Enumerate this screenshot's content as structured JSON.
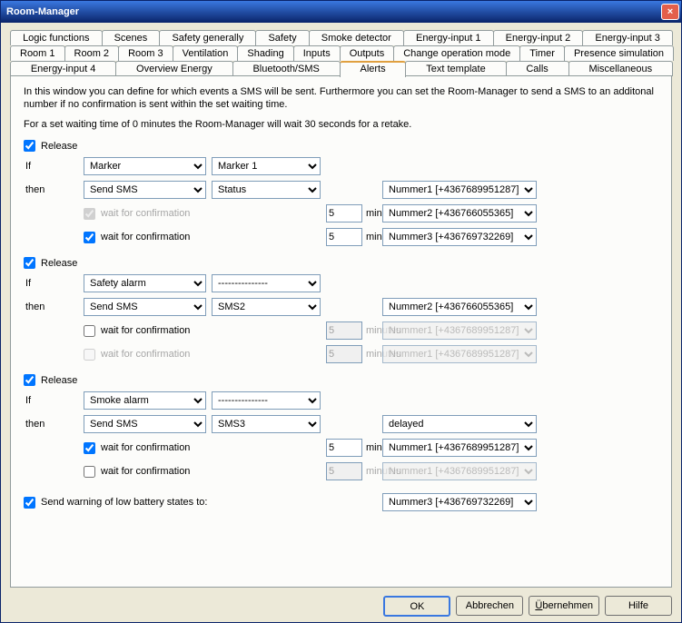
{
  "window": {
    "title": "Room-Manager"
  },
  "tabs": {
    "row1": [
      "Logic functions",
      "Scenes",
      "Safety generally",
      "Safety",
      "Smoke detector",
      "Energy-input 1",
      "Energy-input 2",
      "Energy-input 3"
    ],
    "row2": [
      "Room 1",
      "Room 2",
      "Room 3",
      "Ventilation",
      "Shading",
      "Inputs",
      "Outputs",
      "Change operation mode",
      "Timer",
      "Presence simulation"
    ],
    "row3": [
      "Energy-input 4",
      "Overview Energy",
      "Bluetooth/SMS",
      "Alerts",
      "Text template",
      "Calls",
      "Miscellaneous"
    ],
    "active": "Alerts"
  },
  "intro": {
    "p1": "In this window you can define for which events a SMS will be sent. Furthermore you can set the Room-Manager to send a SMS to an additonal number if no confirmation is sent within the set waiting time.",
    "p2": "For a set waiting time of 0 minutes the Room-Manager will wait 30 seconds for a retake."
  },
  "labels": {
    "release": "Release",
    "if": "If",
    "then": "then",
    "wait": "wait for confirmation",
    "minutes": "minutes",
    "battery": "Send warning of low battery states to:",
    "ok": "OK",
    "cancel": "Abbrechen",
    "apply": "Übernehmen",
    "help": "Hilfe"
  },
  "groups": [
    {
      "release_checked": true,
      "if_source": "Marker",
      "if_detail": "Marker 1",
      "then_action": "Send SMS",
      "then_detail": "Status",
      "then_target": "Nummer1 [+4367689951287]",
      "wait1": {
        "enabled": false,
        "checked": true,
        "disabled_text": true,
        "minutes": "5",
        "minutes_disabled": false,
        "target": "Nummer2 [+436766055365]",
        "target_disabled": false
      },
      "wait2": {
        "enabled": true,
        "checked": true,
        "disabled_text": false,
        "minutes": "5",
        "minutes_disabled": false,
        "target": "Nummer3 [+436769732269]",
        "target_disabled": false
      }
    },
    {
      "release_checked": true,
      "if_source": "Safety alarm",
      "if_detail": "---------------",
      "then_action": "Send SMS",
      "then_detail": "SMS2",
      "then_target": "Nummer2 [+436766055365]",
      "wait1": {
        "enabled": true,
        "checked": false,
        "disabled_text": false,
        "minutes": "5",
        "minutes_disabled": true,
        "target": "Nummer1 [+4367689951287]",
        "target_disabled": true
      },
      "wait2": {
        "enabled": false,
        "checked": false,
        "disabled_text": true,
        "minutes": "5",
        "minutes_disabled": true,
        "target": "Nummer1 [+4367689951287]",
        "target_disabled": true
      }
    },
    {
      "release_checked": true,
      "if_source": "Smoke alarm",
      "if_detail": "---------------",
      "then_action": "Send SMS",
      "then_detail": "SMS3",
      "then_target": "delayed",
      "wait1": {
        "enabled": true,
        "checked": true,
        "disabled_text": false,
        "minutes": "5",
        "minutes_disabled": false,
        "target": "Nummer1 [+4367689951287]",
        "target_disabled": false
      },
      "wait2": {
        "enabled": true,
        "checked": false,
        "disabled_text": false,
        "minutes": "5",
        "minutes_disabled": true,
        "target": "Nummer1 [+4367689951287]",
        "target_disabled": true
      }
    }
  ],
  "battery": {
    "checked": true,
    "target": "Nummer3 [+436769732269]"
  }
}
